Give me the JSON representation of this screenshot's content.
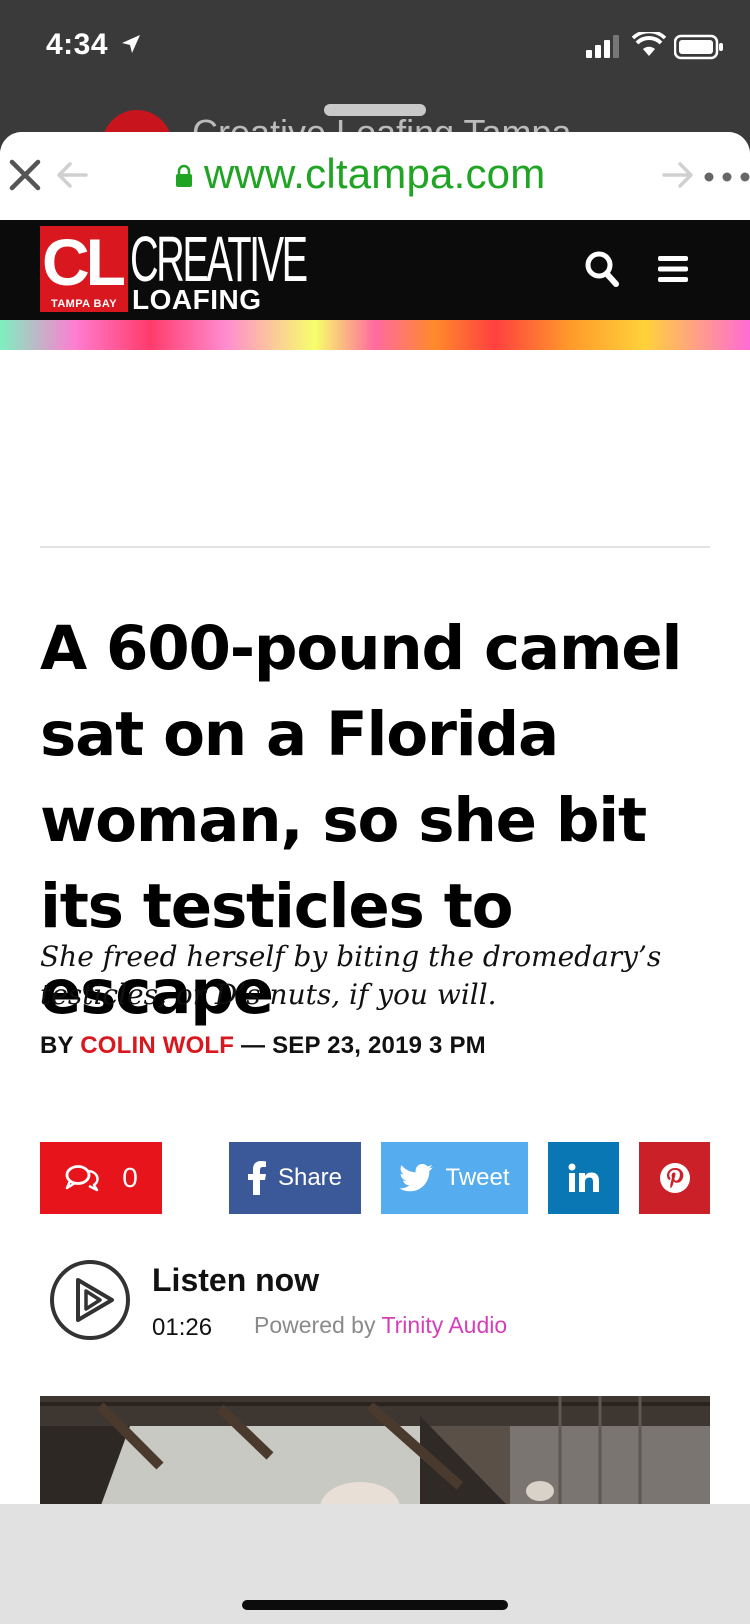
{
  "status_bar": {
    "time": "4:34"
  },
  "behind_sheet": {
    "title": "Creative Loafing Tampa"
  },
  "browser": {
    "url": "www.cltampa.com"
  },
  "site": {
    "logo": {
      "cl": "CL",
      "tampa_bay": "TAMPA BAY",
      "creative": "CREATIVE",
      "loafing": "LOAFING"
    }
  },
  "article": {
    "headline": "A 600-pound camel sat on a Florida woman, so she bit its testicles to escape",
    "dek": "She freed herself by biting the dromedary’s testicles, or D’s nuts, if you will.",
    "byline": {
      "prefix": "BY ",
      "author": "COLIN WOLF",
      "separator": " — ",
      "date": "SEP 23, 2019 3 PM"
    }
  },
  "share": {
    "comments_count": "0",
    "facebook_label": "Share",
    "twitter_label": "Tweet"
  },
  "audio": {
    "title": "Listen now",
    "duration": "01:26",
    "powered_by": "Powered by",
    "brand": "Trinity Audio"
  },
  "colors": {
    "url_green": "#1fa523",
    "brand_red": "#d9171f",
    "facebook": "#3b5998",
    "twitter": "#55acee",
    "linkedin": "#0a77b5",
    "pinterest": "#cb2027",
    "trinity_pink": "#d53fb8"
  }
}
